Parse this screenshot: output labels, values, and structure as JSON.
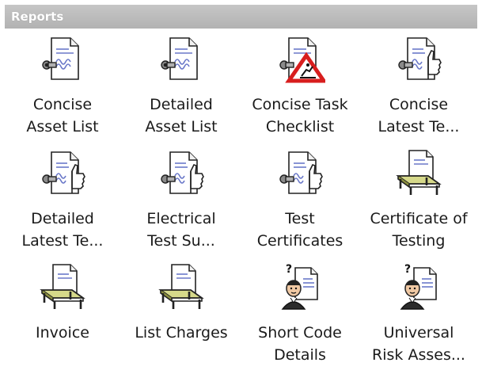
{
  "header": {
    "title": "Reports"
  },
  "reports": [
    {
      "id": "concise-asset-list",
      "icon": "document-probe-icon",
      "line1": "Concise",
      "line2": "Asset List"
    },
    {
      "id": "detailed-asset-list",
      "icon": "document-probe-icon",
      "line1": "Detailed",
      "line2": "Asset List"
    },
    {
      "id": "concise-task-checklist",
      "icon": "document-warning-icon",
      "line1": "Concise Task",
      "line2": "Checklist"
    },
    {
      "id": "concise-latest-tests",
      "icon": "document-thumb-icon",
      "line1": "Concise",
      "line2": "Latest Te..."
    },
    {
      "id": "detailed-latest-tests",
      "icon": "document-thumb-icon",
      "line1": "Detailed",
      "line2": "Latest Te..."
    },
    {
      "id": "electrical-test-summary",
      "icon": "document-thumb-icon",
      "line1": "Electrical",
      "line2": "Test Su..."
    },
    {
      "id": "test-certificates",
      "icon": "document-thumb-icon",
      "line1": "Test",
      "line2": "Certificates"
    },
    {
      "id": "certificate-of-testing",
      "icon": "document-table-icon",
      "line1": "Certificate of",
      "line2": "Testing"
    },
    {
      "id": "invoice",
      "icon": "document-table-icon",
      "line1": "Invoice",
      "line2": ""
    },
    {
      "id": "list-charges",
      "icon": "document-table-icon",
      "line1": "List Charges",
      "line2": ""
    },
    {
      "id": "short-code-details",
      "icon": "document-person-icon",
      "line1": "Short Code",
      "line2": "Details"
    },
    {
      "id": "universal-risk-assessment",
      "icon": "document-person-icon",
      "line1": "Universal",
      "line2": "Risk Asses..."
    }
  ],
  "colors": {
    "header_bg": "#b8b8b8",
    "header_text": "#ffffff",
    "doc_fill": "#ffffff",
    "doc_line": "#6b79c9",
    "warning_red": "#d81e1e",
    "table_green": "#d6d98a"
  }
}
